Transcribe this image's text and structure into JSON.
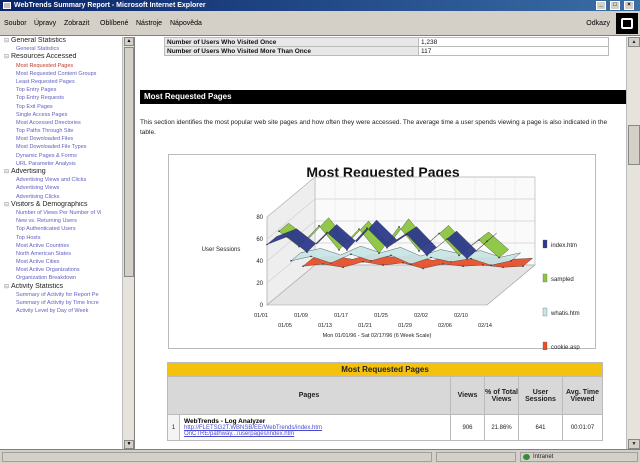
{
  "window": {
    "title": "WebTrends Summary Report - Microsoft Internet Explorer"
  },
  "menubar": {
    "items": [
      "Soubor",
      "Úpravy",
      "Zobrazit",
      "Oblíbené",
      "Nástroje",
      "Nápověda"
    ],
    "links_label": "Odkazy"
  },
  "sidebar": {
    "lines": [
      {
        "text": "General Statistics",
        "group": true
      },
      {
        "text": "General Statistics",
        "group": false
      },
      {
        "text": "Resources Accessed",
        "group": true
      },
      {
        "text": "Most Requested Pages",
        "group": false,
        "active": true
      },
      {
        "text": "Most Requested Content Groups",
        "group": false
      },
      {
        "text": "Least Requested Pages",
        "group": false
      },
      {
        "text": "Top Entry Pages",
        "group": false
      },
      {
        "text": "Top Entry Requests",
        "group": false
      },
      {
        "text": "Top Exit Pages",
        "group": false
      },
      {
        "text": "Single Access Pages",
        "group": false
      },
      {
        "text": "Most Accessed Directories",
        "group": false
      },
      {
        "text": "Top Paths Through Site",
        "group": false
      },
      {
        "text": "Most Downloaded Files",
        "group": false
      },
      {
        "text": "Most Downloaded File Types",
        "group": false
      },
      {
        "text": "Dynamic Pages & Forms",
        "group": false
      },
      {
        "text": "URL Parameter Analysis",
        "group": false
      },
      {
        "text": "Advertising",
        "group": true
      },
      {
        "text": "Advertising Views and Clicks",
        "group": false
      },
      {
        "text": "Advertising Views",
        "group": false
      },
      {
        "text": "Advertising Clicks",
        "group": false
      },
      {
        "text": "Visitors & Demographics",
        "group": true
      },
      {
        "text": "Number of Views Per Number of Vi",
        "group": false
      },
      {
        "text": "New vs. Returning Users",
        "group": false
      },
      {
        "text": "Top Authenticated Users",
        "group": false
      },
      {
        "text": "Top Hosts",
        "group": false
      },
      {
        "text": "Most Active Countries",
        "group": false
      },
      {
        "text": "North American States",
        "group": false
      },
      {
        "text": "Most Active Cities",
        "group": false
      },
      {
        "text": "Most Active Organizations",
        "group": false
      },
      {
        "text": "Organization Breakdown",
        "group": false
      },
      {
        "text": "Activity Statistics",
        "group": true
      },
      {
        "text": "Summary of Activity for Report Pe",
        "group": false
      },
      {
        "text": "Summary of Activity by Time Incre",
        "group": false
      },
      {
        "text": "Activity Level by Day of Week",
        "group": false
      }
    ]
  },
  "top_table": {
    "rows": [
      {
        "label": "Number of Users Who Visited Once",
        "value": "1,238"
      },
      {
        "label": "Number of Users Who Visited More Than Once",
        "value": "117"
      }
    ]
  },
  "section": {
    "title": "Most Requested Pages",
    "intro": "This section identifies the most popular web site pages and how often they were accessed. The average time a user spends viewing a page is also indicated in the table."
  },
  "chart_data": {
    "type": "area",
    "title": "Most Requested Pages",
    "ylabel": "User Sessions",
    "xlabel": "Mon 01/01/96 - Sat 02/17/96 (6 Week Scale)",
    "ylim": [
      0,
      80
    ],
    "yticks": [
      0,
      20,
      40,
      60,
      80
    ],
    "categories": [
      "01/01",
      "01/05",
      "01/09",
      "01/13",
      "01/17",
      "01/21",
      "01/25",
      "01/29",
      "02/02",
      "02/06",
      "02/10",
      "02/14"
    ],
    "tick_rows": {
      "front": [
        "01/01",
        "01/09",
        "01/17",
        "01/25",
        "02/02",
        "02/10"
      ],
      "back": [
        "01/05",
        "01/13",
        "01/21",
        "01/29",
        "02/06",
        "02/14"
      ]
    },
    "grid": true,
    "legend_placement": "right",
    "series": [
      {
        "name": "index.htm",
        "color": "#2e3a8c",
        "values": [
          55,
          62,
          48,
          66,
          50,
          70,
          52,
          64,
          45,
          60,
          42,
          58
        ]
      },
      {
        "name": "sampled",
        "color": "#8cc63f",
        "values": [
          58,
          44,
          63,
          41,
          60,
          38,
          62,
          40,
          56,
          36,
          50,
          34
        ]
      },
      {
        "name": "whatis.htm",
        "color": "#c8e6e6",
        "values": [
          22,
          26,
          20,
          28,
          22,
          27,
          19,
          25,
          21,
          24,
          18,
          22
        ]
      },
      {
        "name": "cookie.asp",
        "color": "#e8502a",
        "values": [
          8,
          10,
          7,
          12,
          9,
          11,
          6,
          10,
          8,
          9,
          7,
          8
        ]
      }
    ]
  },
  "requested_table": {
    "caption": "Most Requested Pages",
    "headers": [
      "Pages",
      "Views",
      "% of Total Views",
      "User Sessions",
      "Avg. Time Viewed"
    ],
    "rows": [
      {
        "index": "1",
        "title": "WebTrends - Log Analyzer",
        "url1": "http://FLETSG2T.WBNSB/EE/WebTrends/index.htm",
        "url2": "OnCTRE/pathway.../userpages/index.htm",
        "views": "906",
        "percent": "21.86%",
        "sessions": "641",
        "avg_time": "00:01:07"
      }
    ]
  },
  "statusbar": {
    "zone": "Intranet"
  }
}
